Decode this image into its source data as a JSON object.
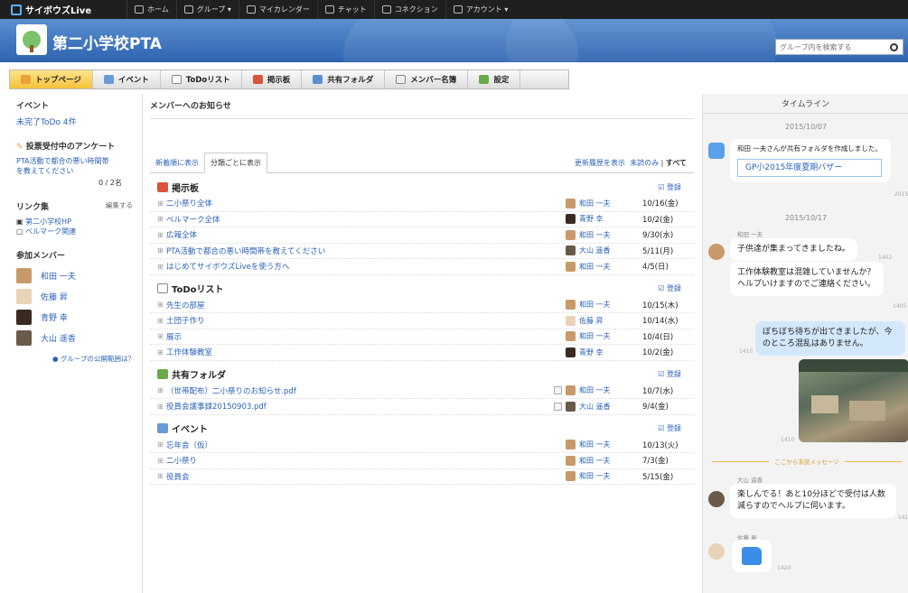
{
  "topnav": {
    "logo": "サイボウズLive",
    "items": [
      "ホーム",
      "グループ ▾",
      "マイカレンダー",
      "チャット",
      "コネクション",
      "アカウント ▾"
    ]
  },
  "header": {
    "title": "第二小学校PTA",
    "search_placeholder": "グループ内を検索する"
  },
  "tabs": [
    "トップページ",
    "イベント",
    "ToDoリスト",
    "掲示板",
    "共有フォルダ",
    "メンバー名簿",
    "設定"
  ],
  "left": {
    "event_title": "イベント",
    "todo_link": "未完了ToDo 4件",
    "survey_title": "投票受付中のアンケート",
    "survey_link": "PTA活動で都合の悪い時間帯を教えてください",
    "survey_count": "0 / 2名",
    "links_title": "リンク集",
    "links_edit": "編集する",
    "links": [
      "第二小学校HP",
      "ベルマーク関連"
    ],
    "members_title": "参加メンバー",
    "members": [
      "和田 一夫",
      "佐藤 昇",
      "青野 幸",
      "大山 遥香"
    ],
    "help_link": "グループの公開範囲は？"
  },
  "main": {
    "heading": "メンバーへのお知らせ",
    "subtab_new": "新着順に表示",
    "subtab_cat": "分類ごとに表示",
    "history": "更新履歴を表示",
    "unread": "未読のみ",
    "all": "すべて",
    "register": "登録",
    "sections": [
      {
        "title": "掲示板",
        "rows": [
          {
            "name": "二小祭り全体",
            "who": "和田 一夫",
            "date": "10/16(金)"
          },
          {
            "name": "ベルマーク全体",
            "who": "青野 幸",
            "date": "10/2(金)"
          },
          {
            "name": "広報全体",
            "who": "和田 一夫",
            "date": "9/30(水)"
          },
          {
            "name": "PTA活動で都合の悪い時間帯を教えてください",
            "who": "大山 遥香",
            "date": "5/11(月)"
          },
          {
            "name": "はじめてサイボウズLiveを使う方へ",
            "who": "和田 一夫",
            "date": "4/5(日)"
          }
        ]
      },
      {
        "title": "ToDoリスト",
        "rows": [
          {
            "name": "先生の部屋",
            "who": "和田 一夫",
            "date": "10/15(木)"
          },
          {
            "name": "土団子作り",
            "who": "佐藤 昇",
            "date": "10/14(水)"
          },
          {
            "name": "展示",
            "who": "和田 一夫",
            "date": "10/4(日)"
          },
          {
            "name": "工作体験教室",
            "who": "青野 幸",
            "date": "10/2(金)"
          }
        ]
      },
      {
        "title": "共有フォルダ",
        "rows": [
          {
            "name": "（世帯配布）二小祭りのお知らせ.pdf",
            "who": "和田 一夫",
            "date": "10/7(水)"
          },
          {
            "name": "役員会議事録20150903.pdf",
            "who": "大山 遥香",
            "date": "9/4(金)"
          }
        ]
      },
      {
        "title": "イベント",
        "rows": [
          {
            "name": "忘年会（仮）",
            "who": "和田 一夫",
            "date": "10/13(火)"
          },
          {
            "name": "二小祭り",
            "who": "和田 一夫",
            "date": "7/3(金)"
          },
          {
            "name": "役員会",
            "who": "和田 一夫",
            "date": "5/15(金)"
          }
        ]
      }
    ]
  },
  "timeline": {
    "title": "タイムライン",
    "date1": "2015/10/07",
    "sys_msg": "和田 一夫さんが共有フォルダを作成しました。",
    "folder_btn": "GP小2015年度夏期バザー",
    "t1": "2015",
    "date2": "2015/10/17",
    "name_wada": "和田 一夫",
    "msg1": "子供達が集まってきましたね。",
    "t2": "1402",
    "msg2": "工作体験教室は混雑していませんか？ヘルプいけますのでご連絡ください。",
    "t3": "1405",
    "msg_me": "ぼちぼち待ちが出てきましたが、今のところ混乱はありません。",
    "t4": "1410",
    "t5": "1410",
    "unread_divider": "ここから未読メッセージ",
    "name_oyama": "大山 遥香",
    "msg3": "楽しんでる！あと10分ほどで受付は人数減らすのでヘルプに伺います。",
    "t6": "141",
    "name_sato": "佐藤 昇",
    "t7": "1420"
  }
}
